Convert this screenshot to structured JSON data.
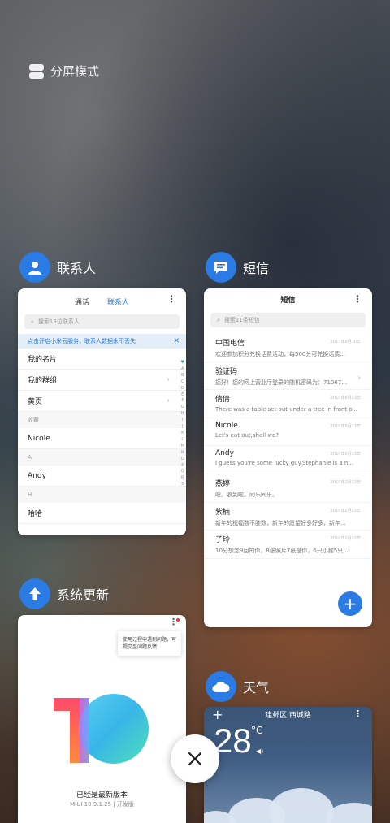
{
  "split_mode": {
    "label": "分屏模式"
  },
  "contacts": {
    "app_name": "联系人",
    "tabs": [
      "通话",
      "联系人"
    ],
    "search_placeholder": "搜索13位联系人",
    "notice": "点击开启小米云服务，联系人数据永不丢失",
    "rows": [
      {
        "type": "item",
        "label": "我的名片",
        "chevron": false
      },
      {
        "type": "item",
        "label": "我的群组",
        "chevron": true
      },
      {
        "type": "item",
        "label": "黄页",
        "chevron": true
      },
      {
        "type": "section",
        "label": "收藏"
      },
      {
        "type": "item",
        "label": "Nicole",
        "chevron": false
      },
      {
        "type": "section",
        "label": "A"
      },
      {
        "type": "item",
        "label": "Andy",
        "chevron": false
      },
      {
        "type": "section",
        "label": "H"
      },
      {
        "type": "item",
        "label": "哈哈",
        "chevron": false
      }
    ],
    "index_letters": [
      "♥",
      "A",
      "B",
      "C",
      "D",
      "E",
      "F",
      "G",
      "H",
      "I",
      "J",
      "K",
      "L",
      "M",
      "N",
      "O",
      "P",
      "Q",
      "R",
      "S"
    ]
  },
  "messages": {
    "app_name": "短信",
    "title": "短信",
    "search_placeholder": "搜索11条短信",
    "threads": [
      {
        "name": "中国电信",
        "date": "2017年8月30日",
        "preview": "欢迎参加积分兑换话费活动，每500分可兑换话费..."
      },
      {
        "name": "验证码",
        "date": "",
        "preview": "您好！您的网上营业厅登录的随机密码为：71067..."
      },
      {
        "name": "倩倩",
        "date": "2019年6月13日",
        "preview": "There was a table set out under a tree in front o..."
      },
      {
        "name": "Nicole",
        "date": "2019年6月13日",
        "preview": "Let's eat out,shall we?"
      },
      {
        "name": "Andy",
        "date": "2019年6月13日",
        "preview": "I guess you're some lucky guy.Stephanie is a n..."
      },
      {
        "name": "燕婷",
        "date": "2019年2月22日",
        "preview": "嗯。收到啦。同乐同乐。"
      },
      {
        "name": "紫楠",
        "date": "2019年2月22日",
        "preview": "新年的祝福数不胜数，新年的愿望好多好多，新年..."
      },
      {
        "name": "子玲",
        "date": "2019年2月22日",
        "preview": "10分想念9回的你，8张照片7张是你，6只小狗5只..."
      }
    ],
    "fab": "+"
  },
  "updater": {
    "app_name": "系统更新",
    "tooltip": "使用过程中遇到问题，可提交至问题反馈",
    "latest": "已经是最新版本",
    "version": "MIUI 10 9.1.25 | 开发版"
  },
  "weather": {
    "app_name": "天气",
    "city": "建邺区 西城路",
    "temperature": "28",
    "unit": "°C",
    "condition": "云"
  },
  "colors": {
    "accent": "#2a7be4",
    "weather_icon": "#2a7be4"
  }
}
